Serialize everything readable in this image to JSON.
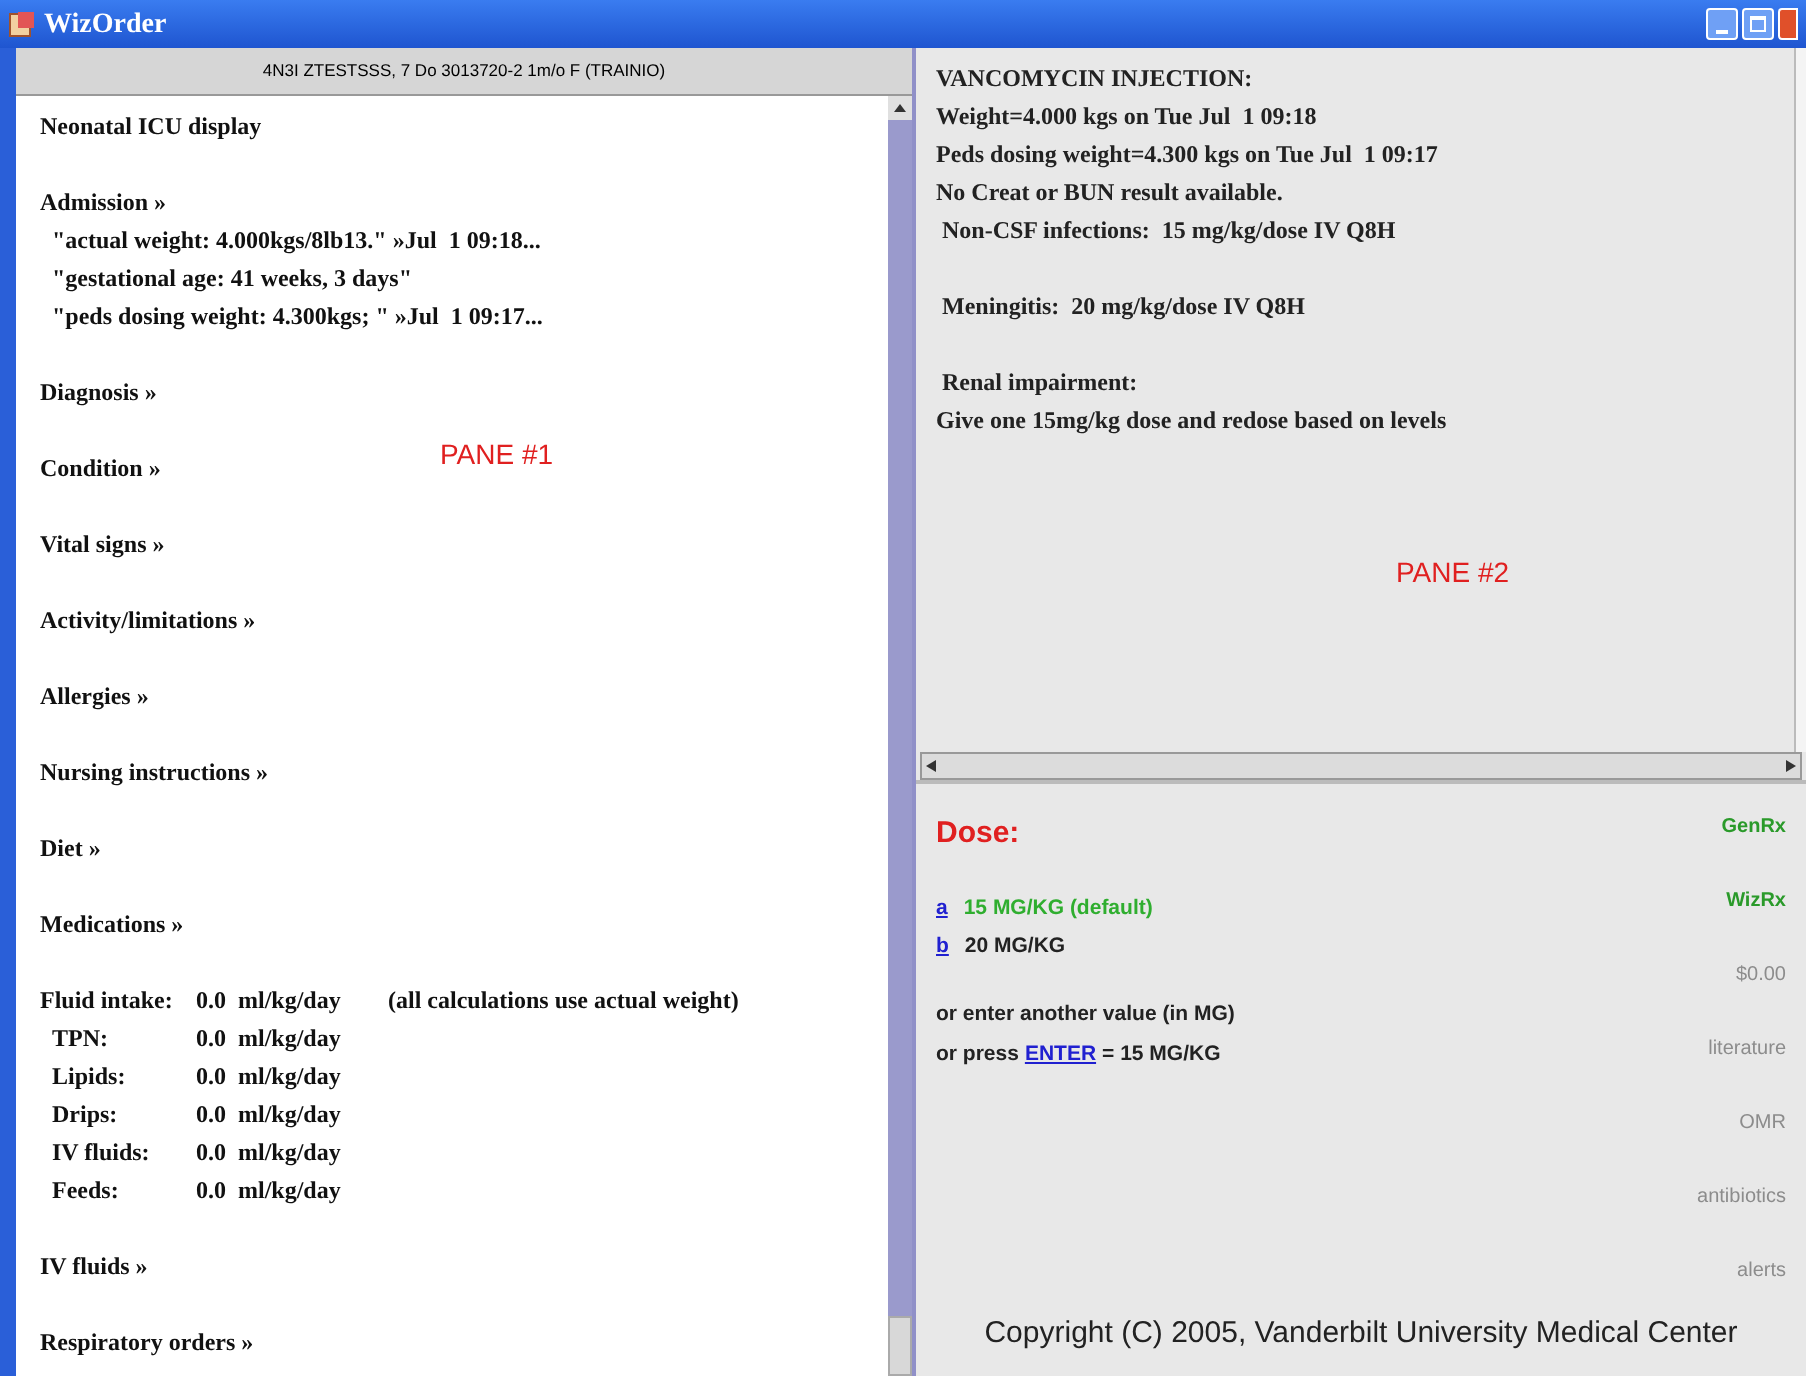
{
  "window": {
    "title": "WizOrder"
  },
  "pane1": {
    "header": "4N3I ZTESTSSS, 7 Do 3013720-2 1m/o F (TRAINIO)",
    "annotation": "PANE #1",
    "items": [
      {
        "kind": "title",
        "text": "Neonatal ICU display"
      },
      {
        "kind": "section",
        "text": "Admission »",
        "lines": [
          "\"actual weight: 4.000kgs/8lb13.\" »Jul  1 09:18...",
          "\"gestational age: 41 weeks, 3 days\"",
          "\"peds dosing weight: 4.300kgs; \" »Jul  1 09:17..."
        ]
      },
      {
        "kind": "section",
        "text": "Diagnosis »"
      },
      {
        "kind": "section",
        "text": "Condition »"
      },
      {
        "kind": "section",
        "text": "Vital signs »"
      },
      {
        "kind": "section",
        "text": "Activity/limitations »"
      },
      {
        "kind": "section",
        "text": "Allergies »"
      },
      {
        "kind": "section",
        "text": "Nursing instructions »"
      },
      {
        "kind": "section",
        "text": "Diet »"
      },
      {
        "kind": "section",
        "text": "Medications »"
      },
      {
        "kind": "fluids",
        "rows": [
          {
            "label": "Fluid intake:",
            "value": "0.0  ml/kg/day",
            "note": "(all calculations use actual weight)"
          },
          {
            "label": "TPN:",
            "value": "0.0  ml/kg/day"
          },
          {
            "label": "Lipids:",
            "value": "0.0  ml/kg/day"
          },
          {
            "label": "Drips:",
            "value": "0.0  ml/kg/day"
          },
          {
            "label": "IV fluids:",
            "value": "0.0  ml/kg/day"
          },
          {
            "label": "Feeds:",
            "value": "0.0  ml/kg/day"
          }
        ]
      },
      {
        "kind": "section",
        "text": "IV fluids »"
      },
      {
        "kind": "section",
        "text": "Respiratory orders »"
      }
    ]
  },
  "pane2": {
    "annotation": "PANE #2",
    "paragraphs": [
      [
        "VANCOMYCIN INJECTION:",
        "Weight=4.000 kgs on Tue Jul  1 09:18",
        "Peds dosing weight=4.300 kgs on Tue Jul  1 09:17",
        "No Creat or BUN result available.",
        " Non-CSF infections:  15 mg/kg/dose IV Q8H"
      ],
      [
        " Meningitis:  20 mg/kg/dose IV Q8H"
      ],
      [
        " Renal impairment:",
        "Give one 15mg/kg dose and redose based on levels"
      ]
    ]
  },
  "dose": {
    "title": "Dose:",
    "options": [
      {
        "key": "a",
        "label": "15 MG/KG (default)",
        "selected": true
      },
      {
        "key": "b",
        "label": "20 MG/KG",
        "selected": false
      }
    ],
    "prompt": "or enter another value (in MG)",
    "press_before": "or press",
    "press_link": "ENTER",
    "press_after": "= 15 MG/KG",
    "copyright": "Copyright (C) 2005, Vanderbilt University Medical Center"
  },
  "side_links": [
    {
      "text": "GenRx",
      "disabled": false
    },
    {
      "text": "WizRx",
      "disabled": false
    },
    {
      "text": "$0.00",
      "disabled": true
    },
    {
      "text": "literature",
      "disabled": true
    },
    {
      "text": "OMR",
      "disabled": true
    },
    {
      "text": "antibiotics",
      "disabled": true
    },
    {
      "text": "alerts",
      "disabled": true
    }
  ]
}
